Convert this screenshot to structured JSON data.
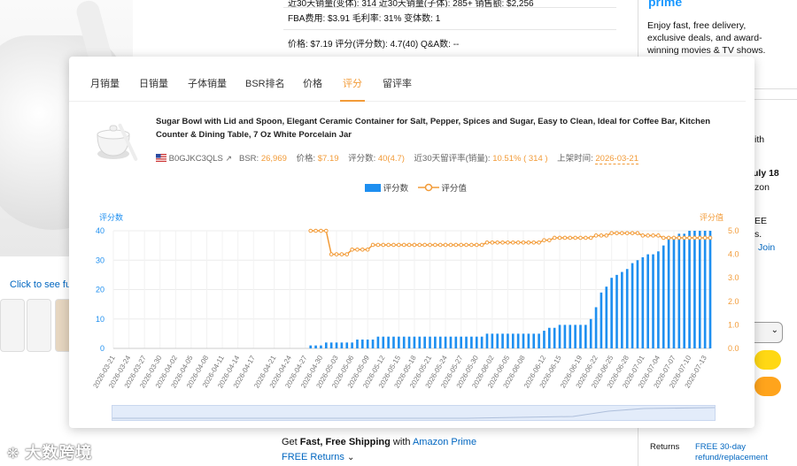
{
  "background": {
    "click_to_see": "Click to see ful",
    "info_line0": "近30天销量(变体): 314    近30天销量(子体): 285+    销售额: $2,256",
    "fba": "FBA费用: $3.91    毛利率: 31%    变体数: 1",
    "price_line": "价格: $7.19    评分(评分数): 4.7(40)    Q&A数: --",
    "prime_logo": "prime",
    "prime_text": "Enjoy fast, free delivery, exclusive deals, and award-winning movies & TV shows.",
    "rb_lines": [
      "ith",
      "uly 18",
      "zon",
      "EE",
      "s.",
      "Join"
    ],
    "shipping_prefix": "Get ",
    "shipping_bold": "Fast, Free Shipping",
    "shipping_mid": " with ",
    "shipping_link": "Amazon Prime",
    "free_returns": "FREE Returns",
    "returns_label": "Returns",
    "returns_value": "FREE 30-day refund/replacement",
    "watermark": "大数跨境"
  },
  "tabs": [
    "月销量",
    "日销量",
    "子体销量",
    "BSR排名",
    "价格",
    "评分",
    "留评率"
  ],
  "active_tab": "评分",
  "product": {
    "title": "Sugar Bowl with Lid and Spoon, Elegant Ceramic Container for Salt, Pepper, Spices and Sugar, Easy to Clean, Ideal for Coffee Bar, Kitchen Counter & Dining Table, 7 Oz White Porcelain Jar",
    "asin": "B0GJKC3QLS",
    "bsr_label": "BSR:",
    "bsr": "26,969",
    "price_label": "价格:",
    "price": "$7.19",
    "rating_label": "评分数:",
    "rating": "40(4.7)",
    "retention_label": "近30天留评率(销量):",
    "retention": "10.51% ( 314 )",
    "listed_label": "上架时间:",
    "listed": "2026-03-21"
  },
  "colors": {
    "bar": "#1e8ff0",
    "line": "#f29b38",
    "accent": "#f29b38"
  },
  "chart_data": {
    "type": "bar",
    "legend": [
      "评分数",
      "评分值"
    ],
    "y_left_label": "评分数",
    "y_right_label": "评分值",
    "y_left_ticks": [
      "0",
      "10",
      "20",
      "30",
      "40"
    ],
    "y_right_ticks": [
      "0.0",
      "1.0",
      "2.0",
      "3.0",
      "4.0",
      "5.0"
    ],
    "ylim_left": [
      0,
      40
    ],
    "ylim_right": [
      0,
      5
    ],
    "x_tick_labels": [
      "2026-03-21",
      "2026-03-24",
      "2026-03-27",
      "2026-03-30",
      "2026-04-02",
      "2026-04-05",
      "2026-04-08",
      "2026-04-11",
      "2026-04-14",
      "2026-04-17",
      "2026-04-21",
      "2026-04-24",
      "2026-04-27",
      "2026-04-30",
      "2026-05-03",
      "2026-05-06",
      "2026-05-09",
      "2026-05-12",
      "2026-05-15",
      "2026-05-18",
      "2026-05-21",
      "2026-05-24",
      "2026-05-27",
      "2026-05-30",
      "2026-06-02",
      "2026-06-05",
      "2026-06-08",
      "2026-06-12",
      "2026-06-15",
      "2026-06-19",
      "2026-06-22",
      "2026-06-25",
      "2026-06-28",
      "2026-07-01",
      "2026-07-04",
      "2026-07-07",
      "2026-07-10",
      "2026-07-13"
    ],
    "x_start": "2026-03-21",
    "x_end": "2026-07-14",
    "series": [
      {
        "name": "评分数",
        "kind": "bar",
        "points": [
          [
            "2026-04-28",
            1
          ],
          [
            "2026-04-29",
            1
          ],
          [
            "2026-04-30",
            1
          ],
          [
            "2026-05-01",
            2
          ],
          [
            "2026-05-02",
            2
          ],
          [
            "2026-05-03",
            2
          ],
          [
            "2026-05-04",
            2
          ],
          [
            "2026-05-05",
            2
          ],
          [
            "2026-05-06",
            2
          ],
          [
            "2026-05-07",
            3
          ],
          [
            "2026-05-08",
            3
          ],
          [
            "2026-05-09",
            3
          ],
          [
            "2026-05-10",
            3
          ],
          [
            "2026-05-11",
            4
          ],
          [
            "2026-05-12",
            4
          ],
          [
            "2026-05-13",
            4
          ],
          [
            "2026-05-14",
            4
          ],
          [
            "2026-05-15",
            4
          ],
          [
            "2026-05-16",
            4
          ],
          [
            "2026-05-17",
            4
          ],
          [
            "2026-05-18",
            4
          ],
          [
            "2026-05-19",
            4
          ],
          [
            "2026-05-20",
            4
          ],
          [
            "2026-05-21",
            4
          ],
          [
            "2026-05-22",
            4
          ],
          [
            "2026-05-23",
            4
          ],
          [
            "2026-05-24",
            4
          ],
          [
            "2026-05-25",
            4
          ],
          [
            "2026-05-26",
            4
          ],
          [
            "2026-05-27",
            4
          ],
          [
            "2026-05-28",
            4
          ],
          [
            "2026-05-29",
            4
          ],
          [
            "2026-05-30",
            4
          ],
          [
            "2026-05-31",
            4
          ],
          [
            "2026-06-01",
            5
          ],
          [
            "2026-06-02",
            5
          ],
          [
            "2026-06-03",
            5
          ],
          [
            "2026-06-04",
            5
          ],
          [
            "2026-06-05",
            5
          ],
          [
            "2026-06-06",
            5
          ],
          [
            "2026-06-07",
            5
          ],
          [
            "2026-06-08",
            5
          ],
          [
            "2026-06-09",
            5
          ],
          [
            "2026-06-10",
            5
          ],
          [
            "2026-06-11",
            5
          ],
          [
            "2026-06-12",
            6
          ],
          [
            "2026-06-13",
            7
          ],
          [
            "2026-06-14",
            7
          ],
          [
            "2026-06-15",
            8
          ],
          [
            "2026-06-16",
            8
          ],
          [
            "2026-06-17",
            8
          ],
          [
            "2026-06-18",
            8
          ],
          [
            "2026-06-19",
            8
          ],
          [
            "2026-06-20",
            8
          ],
          [
            "2026-06-21",
            10
          ],
          [
            "2026-06-22",
            14
          ],
          [
            "2026-06-23",
            19
          ],
          [
            "2026-06-24",
            21
          ],
          [
            "2026-06-25",
            24
          ],
          [
            "2026-06-26",
            25
          ],
          [
            "2026-06-27",
            26
          ],
          [
            "2026-06-28",
            27
          ],
          [
            "2026-06-29",
            29
          ],
          [
            "2026-06-30",
            30
          ],
          [
            "2026-07-01",
            31
          ],
          [
            "2026-07-02",
            32
          ],
          [
            "2026-07-03",
            32
          ],
          [
            "2026-07-04",
            33
          ],
          [
            "2026-07-05",
            35
          ],
          [
            "2026-07-06",
            37
          ],
          [
            "2026-07-07",
            38
          ],
          [
            "2026-07-08",
            39
          ],
          [
            "2026-07-09",
            39
          ],
          [
            "2026-07-10",
            40
          ],
          [
            "2026-07-11",
            40
          ],
          [
            "2026-07-12",
            40
          ],
          [
            "2026-07-13",
            40
          ],
          [
            "2026-07-14",
            40
          ]
        ]
      },
      {
        "name": "评分值",
        "kind": "line",
        "points": [
          [
            "2026-04-28",
            5.0
          ],
          [
            "2026-04-29",
            5.0
          ],
          [
            "2026-04-30",
            5.0
          ],
          [
            "2026-05-01",
            5.0
          ],
          [
            "2026-05-02",
            4.0
          ],
          [
            "2026-05-03",
            4.0
          ],
          [
            "2026-05-04",
            4.0
          ],
          [
            "2026-05-05",
            4.0
          ],
          [
            "2026-05-06",
            4.2
          ],
          [
            "2026-05-07",
            4.2
          ],
          [
            "2026-05-08",
            4.2
          ],
          [
            "2026-05-09",
            4.2
          ],
          [
            "2026-05-10",
            4.4
          ],
          [
            "2026-05-11",
            4.4
          ],
          [
            "2026-05-12",
            4.4
          ],
          [
            "2026-05-13",
            4.4
          ],
          [
            "2026-05-14",
            4.4
          ],
          [
            "2026-05-15",
            4.4
          ],
          [
            "2026-05-16",
            4.4
          ],
          [
            "2026-05-17",
            4.4
          ],
          [
            "2026-05-18",
            4.4
          ],
          [
            "2026-05-19",
            4.4
          ],
          [
            "2026-05-20",
            4.4
          ],
          [
            "2026-05-21",
            4.4
          ],
          [
            "2026-05-22",
            4.4
          ],
          [
            "2026-05-23",
            4.4
          ],
          [
            "2026-05-24",
            4.4
          ],
          [
            "2026-05-25",
            4.4
          ],
          [
            "2026-05-26",
            4.4
          ],
          [
            "2026-05-27",
            4.4
          ],
          [
            "2026-05-28",
            4.4
          ],
          [
            "2026-05-29",
            4.4
          ],
          [
            "2026-05-30",
            4.4
          ],
          [
            "2026-05-31",
            4.4
          ],
          [
            "2026-06-01",
            4.5
          ],
          [
            "2026-06-02",
            4.5
          ],
          [
            "2026-06-03",
            4.5
          ],
          [
            "2026-06-04",
            4.5
          ],
          [
            "2026-06-05",
            4.5
          ],
          [
            "2026-06-06",
            4.5
          ],
          [
            "2026-06-07",
            4.5
          ],
          [
            "2026-06-08",
            4.5
          ],
          [
            "2026-06-09",
            4.5
          ],
          [
            "2026-06-10",
            4.5
          ],
          [
            "2026-06-11",
            4.5
          ],
          [
            "2026-06-12",
            4.6
          ],
          [
            "2026-06-13",
            4.6
          ],
          [
            "2026-06-14",
            4.7
          ],
          [
            "2026-06-15",
            4.7
          ],
          [
            "2026-06-16",
            4.7
          ],
          [
            "2026-06-17",
            4.7
          ],
          [
            "2026-06-18",
            4.7
          ],
          [
            "2026-06-19",
            4.7
          ],
          [
            "2026-06-20",
            4.7
          ],
          [
            "2026-06-21",
            4.7
          ],
          [
            "2026-06-22",
            4.8
          ],
          [
            "2026-06-23",
            4.8
          ],
          [
            "2026-06-24",
            4.8
          ],
          [
            "2026-06-25",
            4.9
          ],
          [
            "2026-06-26",
            4.9
          ],
          [
            "2026-06-27",
            4.9
          ],
          [
            "2026-06-28",
            4.9
          ],
          [
            "2026-06-29",
            4.9
          ],
          [
            "2026-06-30",
            4.9
          ],
          [
            "2026-07-01",
            4.8
          ],
          [
            "2026-07-02",
            4.8
          ],
          [
            "2026-07-03",
            4.8
          ],
          [
            "2026-07-04",
            4.8
          ],
          [
            "2026-07-05",
            4.7
          ],
          [
            "2026-07-06",
            4.7
          ],
          [
            "2026-07-07",
            4.7
          ],
          [
            "2026-07-08",
            4.7
          ],
          [
            "2026-07-09",
            4.7
          ],
          [
            "2026-07-10",
            4.7
          ],
          [
            "2026-07-11",
            4.7
          ],
          [
            "2026-07-12",
            4.7
          ],
          [
            "2026-07-13",
            4.7
          ],
          [
            "2026-07-14",
            4.7
          ]
        ]
      }
    ],
    "grid": true
  }
}
